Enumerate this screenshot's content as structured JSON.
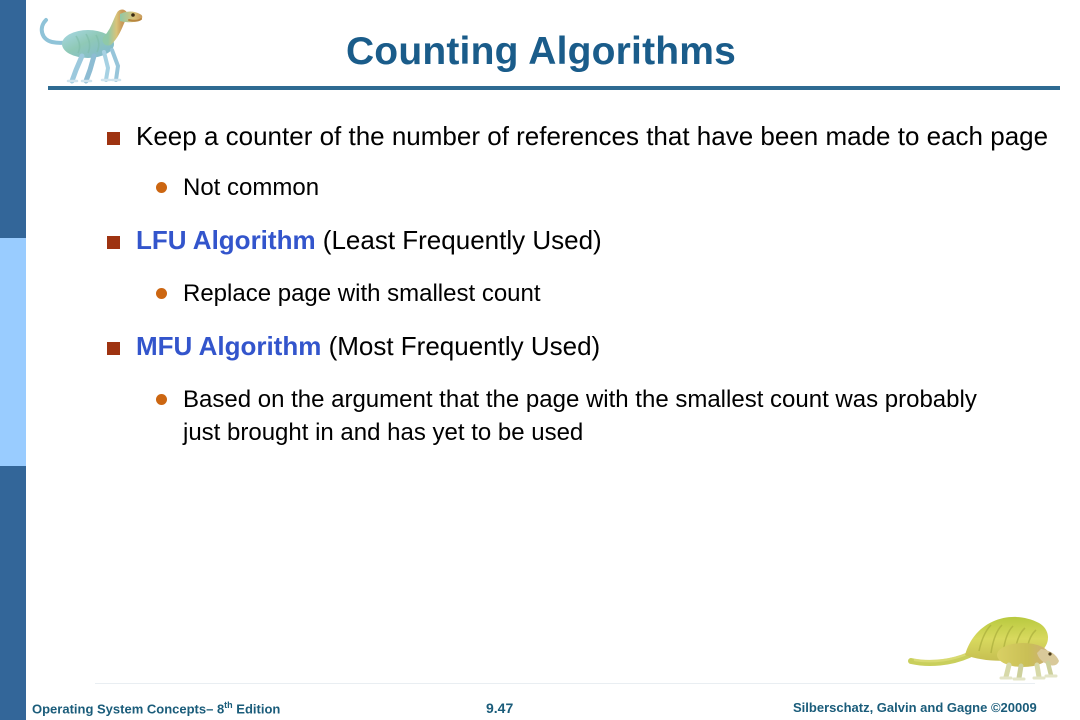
{
  "slide": {
    "title": "Counting Algorithms",
    "page_number": "9.47"
  },
  "colors": {
    "title": "#1a5c8a",
    "title_rule": "#2e6b92",
    "sidebar_dark": "#336699",
    "sidebar_light": "#99ccff",
    "bullet_square": "#9e3311",
    "bullet_dot": "#cc6611",
    "accent_text": "#3355cc",
    "footer_text": "#1a5c7a"
  },
  "content": {
    "b1": {
      "text": "Keep a counter of the number of references that have been made to each page"
    },
    "b1s1": {
      "text": "Not common"
    },
    "b2": {
      "accent": "LFU Algorithm",
      "rest": " (Least Frequently Used)"
    },
    "b2s1": {
      "text": "Replace page with smallest count"
    },
    "b3": {
      "accent": "MFU Algorithm",
      "rest": " (Most Frequently Used)"
    },
    "b3s1": {
      "text": "Based on the argument that the page with the smallest count was probably just brought in and has yet to be used"
    }
  },
  "footer": {
    "edition_prefix": "Operating System Concepts– 8",
    "edition_sup": "th",
    "edition_suffix": " Edition",
    "copyright": "Silberschatz, Galvin and Gagne ©20009"
  },
  "icons": {
    "dino_top": "dinosaur-theropod-icon",
    "dino_bottom": "dinosaur-sailback-icon"
  }
}
